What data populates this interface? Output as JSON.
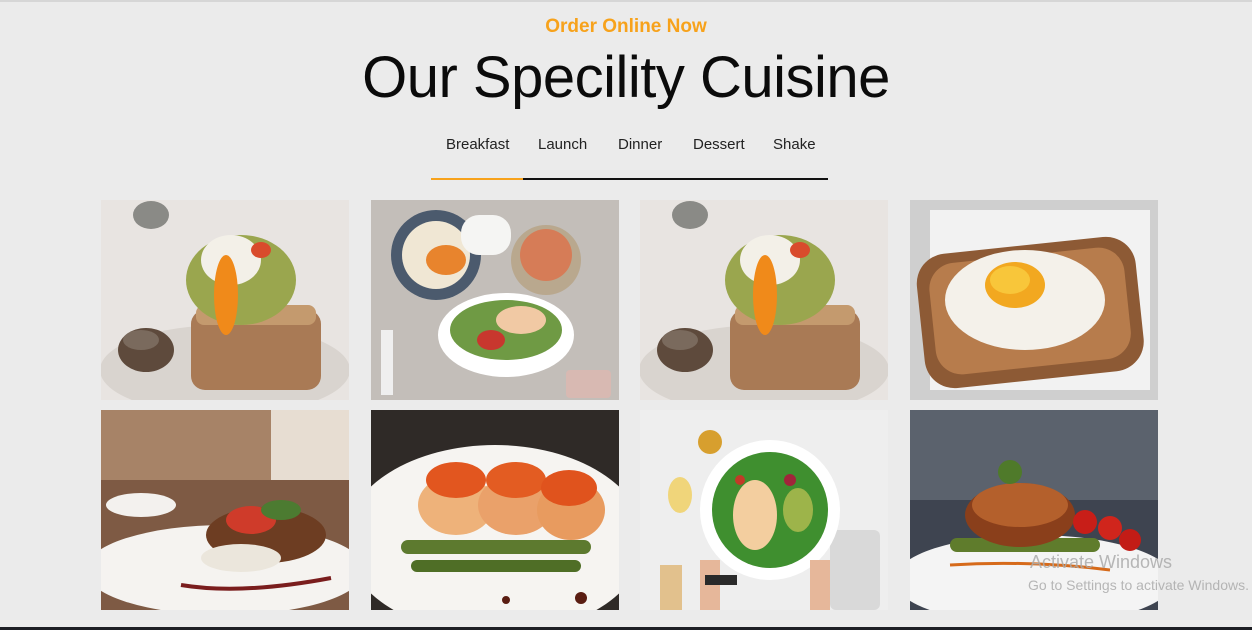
{
  "section": {
    "eyebrow": "Order Online Now",
    "title": "Our Specility Cuisine"
  },
  "tabs": [
    {
      "label": "Breakfast",
      "active": true
    },
    {
      "label": "Launch",
      "active": false
    },
    {
      "label": "Dinner",
      "active": false
    },
    {
      "label": "Dessert",
      "active": false
    },
    {
      "label": "Shake",
      "active": false
    }
  ],
  "gallery": [
    {
      "name": "avocado-toast-egg-photo"
    },
    {
      "name": "brunch-table-salad-photo"
    },
    {
      "name": "avocado-toast-egg-photo"
    },
    {
      "name": "fried-egg-toast-photo"
    },
    {
      "name": "seared-fish-plate-photo"
    },
    {
      "name": "tomato-chicken-rolls-photo"
    },
    {
      "name": "chicken-salad-bowl-photo"
    },
    {
      "name": "steak-tomato-plate-photo"
    }
  ],
  "watermark": {
    "line1": "Activate Windows",
    "line2": "Go to Settings to activate Windows."
  },
  "colors": {
    "accent": "#f7a21b",
    "background": "#ebebeb",
    "text": "#0b0b0b"
  }
}
